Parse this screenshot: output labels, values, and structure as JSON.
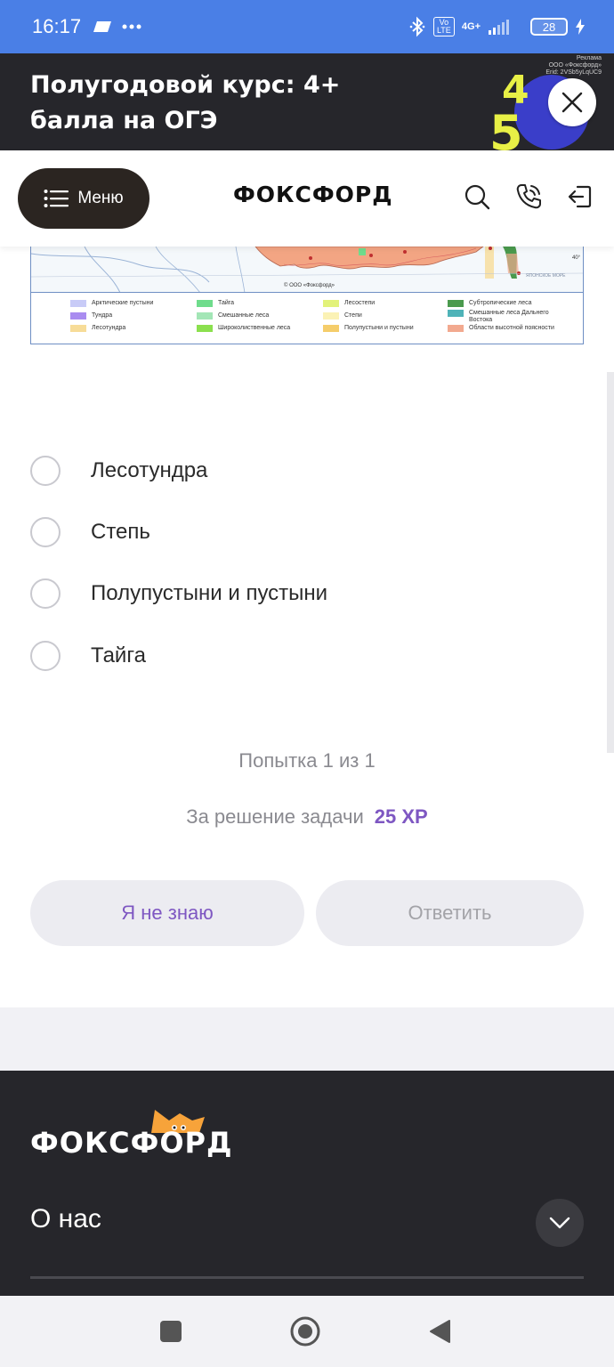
{
  "status_bar": {
    "time": "16:17",
    "network": "4G+",
    "volte": "Vo LTE",
    "battery": "28"
  },
  "ad": {
    "title": "Полугодовой курс: 4+ балла на ОГЭ",
    "meta_line1": "Реклама",
    "meta_line2": "ООО «Фоксфорд»",
    "meta_line3": "Erid: 2VSb5yLqUC9",
    "art_digits": [
      "4",
      "5"
    ]
  },
  "header": {
    "menu_label": "Меню",
    "logo": "ФОКСФОРД"
  },
  "map": {
    "copyright": "© ООО «Фоксфорд»",
    "sea_label": "ЯПОНСКОЕ МОРЕ",
    "degree_label": "40°",
    "legend": [
      {
        "label": "Арктические пустыни",
        "color": "#c8cbf7"
      },
      {
        "label": "Тундра",
        "color": "#a98cf0"
      },
      {
        "label": "Лесотундра",
        "color": "#f7dc98"
      },
      {
        "label": "Тайга",
        "color": "#6fdc8c"
      },
      {
        "label": "Смешанные леса",
        "color": "#a3e6b6"
      },
      {
        "label": "Широколиственные леса",
        "color": "#8be04e"
      },
      {
        "label": "Лесостепи",
        "color": "#e2f27a"
      },
      {
        "label": "Степи",
        "color": "#fbf2b5"
      },
      {
        "label": "Полупустыни и пустыни",
        "color": "#f5cd6b"
      },
      {
        "label": "Субтропические леса",
        "color": "#4a9a4d"
      },
      {
        "label": "Смешанные леса Дальнего Востока",
        "color": "#4fb3b8"
      },
      {
        "label": "Области высотной поясности",
        "color": "#f2a98f"
      }
    ]
  },
  "options": [
    {
      "label": "Лесотундра"
    },
    {
      "label": "Степь"
    },
    {
      "label": "Полупустыни и пустыни"
    },
    {
      "label": "Тайга"
    }
  ],
  "attempt": "Попытка 1 из 1",
  "reward": {
    "text": "За решение задачи",
    "xp": "25 XP",
    "xp_color": "#7e57c2"
  },
  "buttons": {
    "dont_know": "Я не знаю",
    "answer": "Ответить"
  },
  "footer": {
    "logo": "ФОКСФОРД",
    "about": "О нас"
  },
  "nav_bar": {
    "icons": [
      "recents-square-icon",
      "home-circle-icon",
      "back-triangle-icon"
    ]
  }
}
